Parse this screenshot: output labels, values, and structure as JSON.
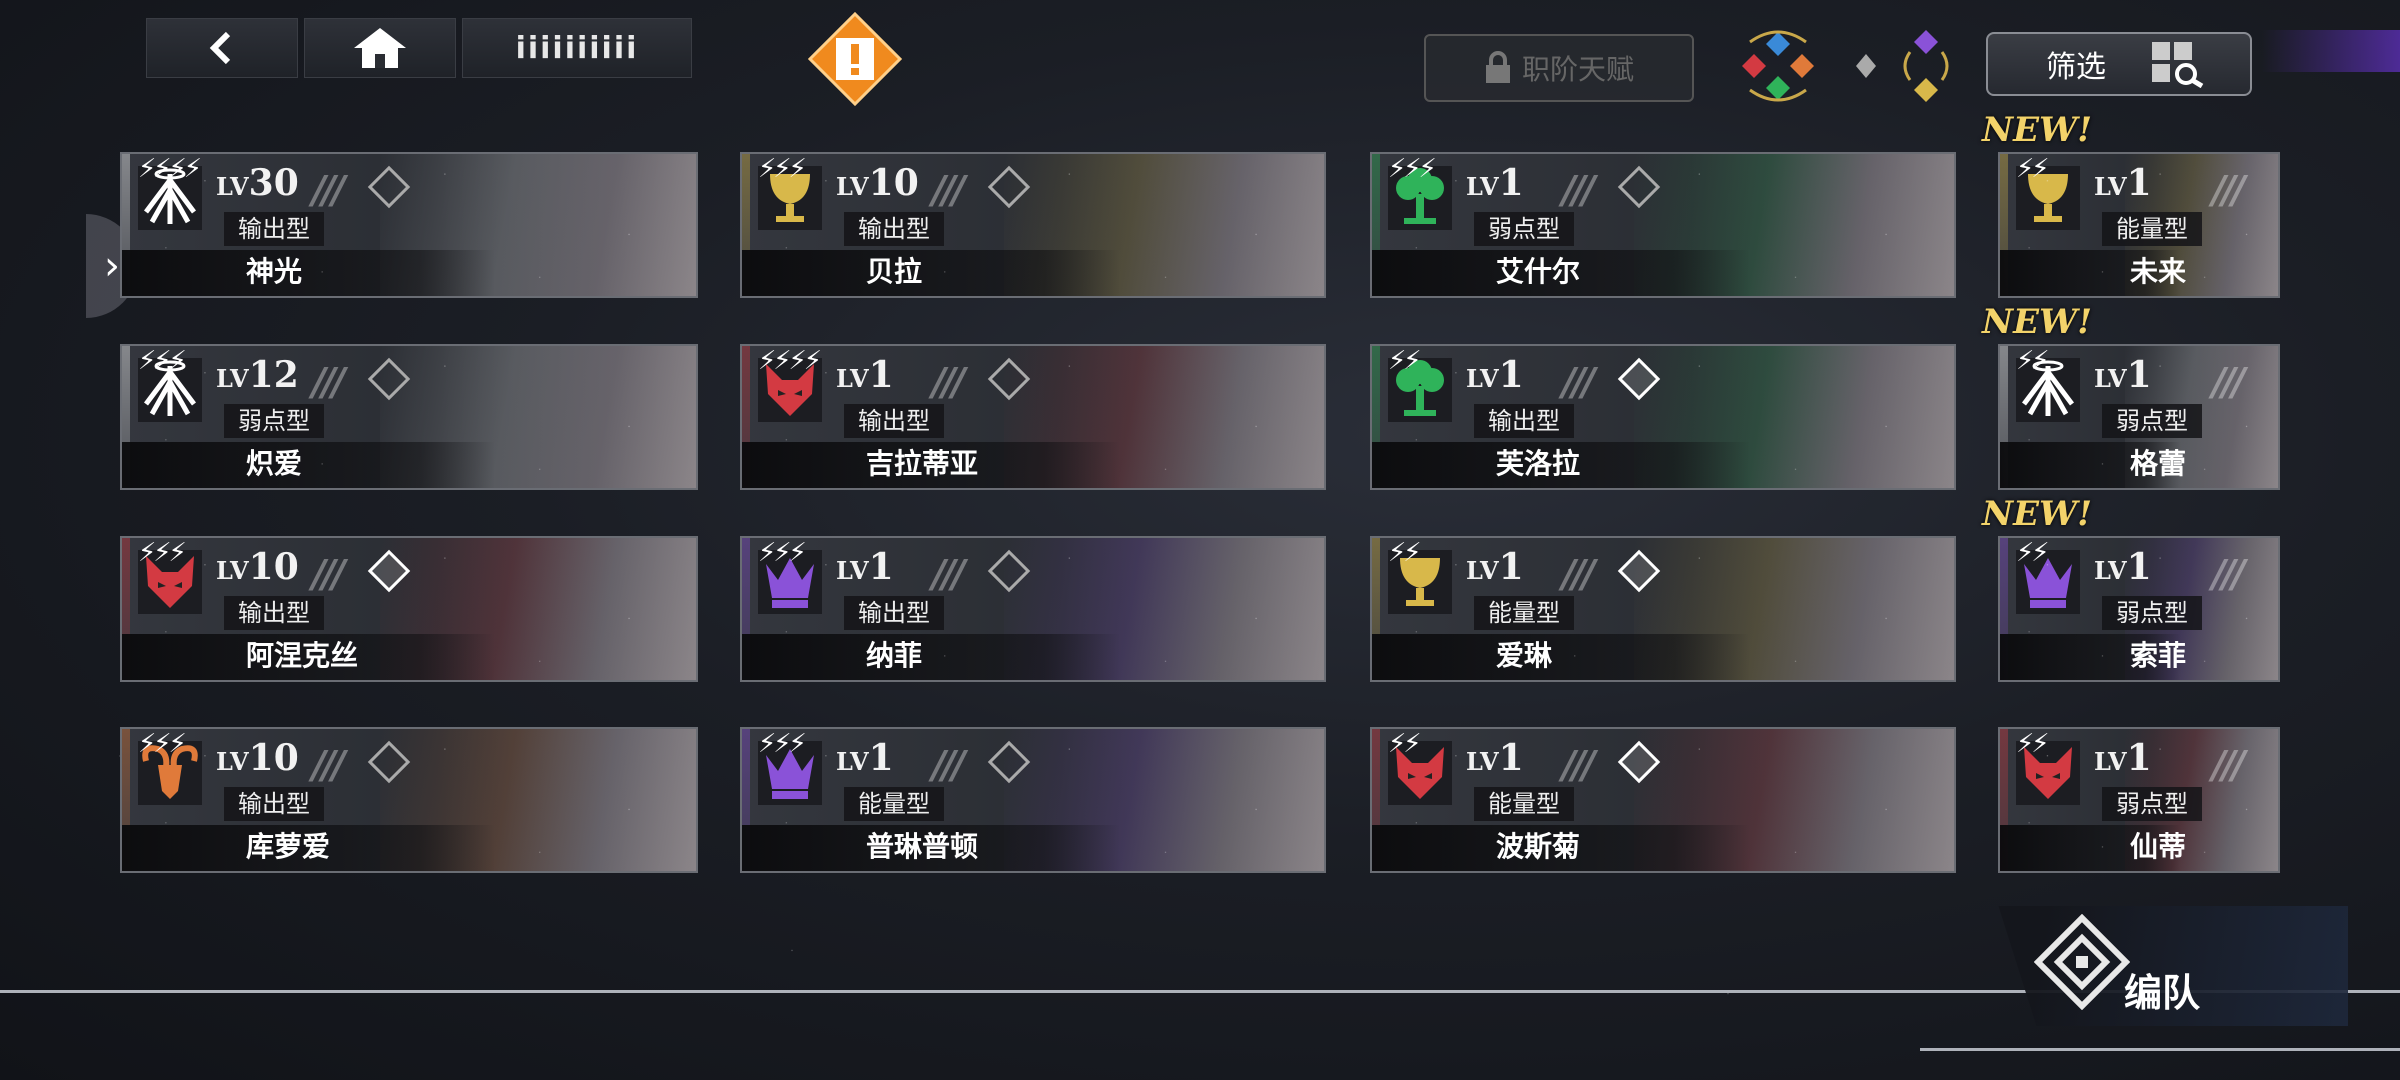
{
  "topbar": {
    "title": "iiiiiiiiii",
    "talent_label": "职阶天赋",
    "filter_label": "筛选"
  },
  "colors": {
    "gold": "#d8b84a",
    "red": "#d33a42",
    "green": "#2fb35a",
    "purple": "#8a52d8",
    "orange": "#e07a3a",
    "blue": "#3a8ad8",
    "alert": "#f08a1e",
    "new": "#f3d36a"
  },
  "cards": [
    {
      "level": "30",
      "type": "输出型",
      "name": "神光",
      "stars": "⚡⚡⚡⚡",
      "icon": "wings-icon",
      "color": "#ffffff"
    },
    {
      "level": "10",
      "type": "输出型",
      "name": "贝拉",
      "stars": "⚡⚡⚡",
      "icon": "chalice-icon",
      "color": "#d8b84a"
    },
    {
      "level": "1",
      "type": "弱点型",
      "name": "艾什尔",
      "stars": "⚡⚡⚡",
      "icon": "tree-icon",
      "color": "#2fb35a"
    },
    {
      "level": "1",
      "type": "能量型",
      "name": "未来",
      "stars": "⚡⚡",
      "icon": "chalice-icon",
      "color": "#d8b84a",
      "new": "NEW!"
    },
    {
      "level": "12",
      "type": "弱点型",
      "name": "炽爱",
      "stars": "⚡⚡⚡",
      "icon": "wings-icon",
      "color": "#ffffff"
    },
    {
      "level": "1",
      "type": "输出型",
      "name": "吉拉蒂亚",
      "stars": "⚡⚡⚡⚡",
      "icon": "wolf-icon",
      "color": "#d33a42"
    },
    {
      "level": "1",
      "type": "输出型",
      "name": "芙洛拉",
      "stars": "⚡⚡",
      "icon": "tree-icon",
      "color": "#2fb35a"
    },
    {
      "level": "1",
      "type": "弱点型",
      "name": "格蕾",
      "stars": "⚡⚡",
      "icon": "wings-icon",
      "color": "#ffffff",
      "new": "NEW!"
    },
    {
      "level": "10",
      "type": "输出型",
      "name": "阿涅克丝",
      "stars": "⚡⚡⚡",
      "icon": "wolf-icon",
      "color": "#d33a42"
    },
    {
      "level": "1",
      "type": "输出型",
      "name": "纳菲",
      "stars": "⚡⚡⚡",
      "icon": "crown-icon",
      "color": "#8a52d8"
    },
    {
      "level": "1",
      "type": "能量型",
      "name": "爱琳",
      "stars": "⚡⚡",
      "icon": "chalice-icon",
      "color": "#d8b84a"
    },
    {
      "level": "1",
      "type": "弱点型",
      "name": "索菲",
      "stars": "⚡⚡",
      "icon": "crown-icon",
      "color": "#8a52d8",
      "new": "NEW!"
    },
    {
      "level": "10",
      "type": "输出型",
      "name": "库萝爱",
      "stars": "⚡⚡⚡",
      "icon": "ram-icon",
      "color": "#e07a3a"
    },
    {
      "level": "1",
      "type": "能量型",
      "name": "普琳普顿",
      "stars": "⚡⚡⚡",
      "icon": "crown-icon",
      "color": "#8a52d8"
    },
    {
      "level": "1",
      "type": "能量型",
      "name": "波斯菊",
      "stars": "⚡⚡",
      "icon": "wolf-icon",
      "color": "#d33a42"
    },
    {
      "level": "1",
      "type": "弱点型",
      "name": "仙蒂",
      "stars": "⚡⚡",
      "icon": "wolf-icon",
      "color": "#d33a42"
    }
  ],
  "bottom": {
    "team_label": "编队"
  }
}
